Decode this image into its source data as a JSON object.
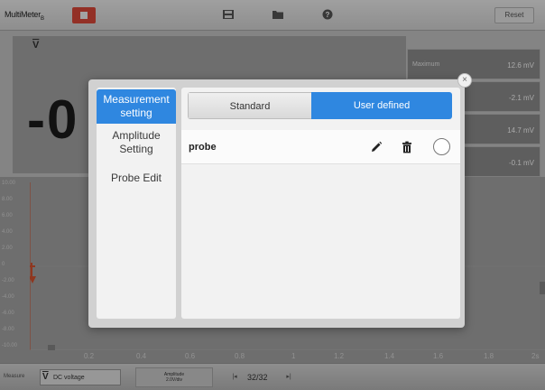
{
  "app": {
    "title": "MultiMeter",
    "subscript": "B"
  },
  "toolbar": {
    "reset_label": "Reset"
  },
  "reading": {
    "unit_label": "V",
    "value": "-0"
  },
  "stats": [
    {
      "label": "Maximum",
      "value": "12.6 mV"
    },
    {
      "label": "",
      "value": "-2.1 mV"
    },
    {
      "label": "",
      "value": "14.7 mV"
    },
    {
      "label": "",
      "value": "-0.1 mV"
    }
  ],
  "graph": {
    "y_ticks": [
      "10.00",
      "8.00",
      "6.00",
      "4.00",
      "2.00",
      "0",
      "-2.00",
      "-4.00",
      "-6.00",
      "-8.00",
      "-10.00"
    ],
    "x_ticks": [
      "0.2",
      "0.4",
      "0.6",
      "0.8",
      "1",
      "1.2",
      "1.4",
      "1.6",
      "1.8",
      "2s"
    ]
  },
  "bottom": {
    "measure_label": "Measure",
    "measure_value": "DC voltage",
    "measure_unit": "V",
    "amplitude_label": "Amplitude",
    "amplitude_value": "2.0V/div",
    "page_text": "32/32"
  },
  "dialog": {
    "sidebar": [
      {
        "label": "Measurement setting",
        "active": true
      },
      {
        "label": "Amplitude Setting",
        "active": false
      },
      {
        "label": "Probe Edit",
        "active": false
      }
    ],
    "tabs": {
      "standard": "Standard",
      "user_defined": "User defined"
    },
    "probe_row": {
      "label": "probe"
    }
  },
  "colors": {
    "accent": "#2f87e0",
    "stop_red": "#e04a3a",
    "trace": "#d9542f"
  }
}
